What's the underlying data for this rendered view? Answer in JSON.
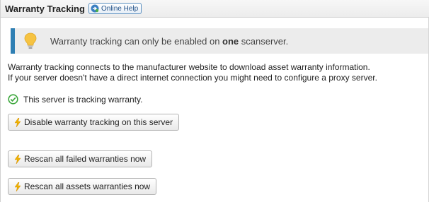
{
  "header": {
    "title": "Warranty Tracking",
    "help_label": "Online Help"
  },
  "notice": {
    "text_before": "Warranty tracking can only be enabled on ",
    "text_bold": "one",
    "text_after": " scanserver."
  },
  "description": {
    "line1": "Warranty tracking connects to the manufacturer website to download asset warranty information.",
    "line2": "If your server doesn't have a direct internet connection you might need to configure a proxy server."
  },
  "status": {
    "text": "This server is tracking warranty."
  },
  "buttons": {
    "disable": "Disable warranty tracking on this server",
    "rescan_failed": "Rescan all failed warranties now",
    "rescan_all": "Rescan all assets warranties now"
  },
  "colors": {
    "accent": "#2f7fb3",
    "check": "#3aa63a",
    "bolt": "#f0b400"
  }
}
